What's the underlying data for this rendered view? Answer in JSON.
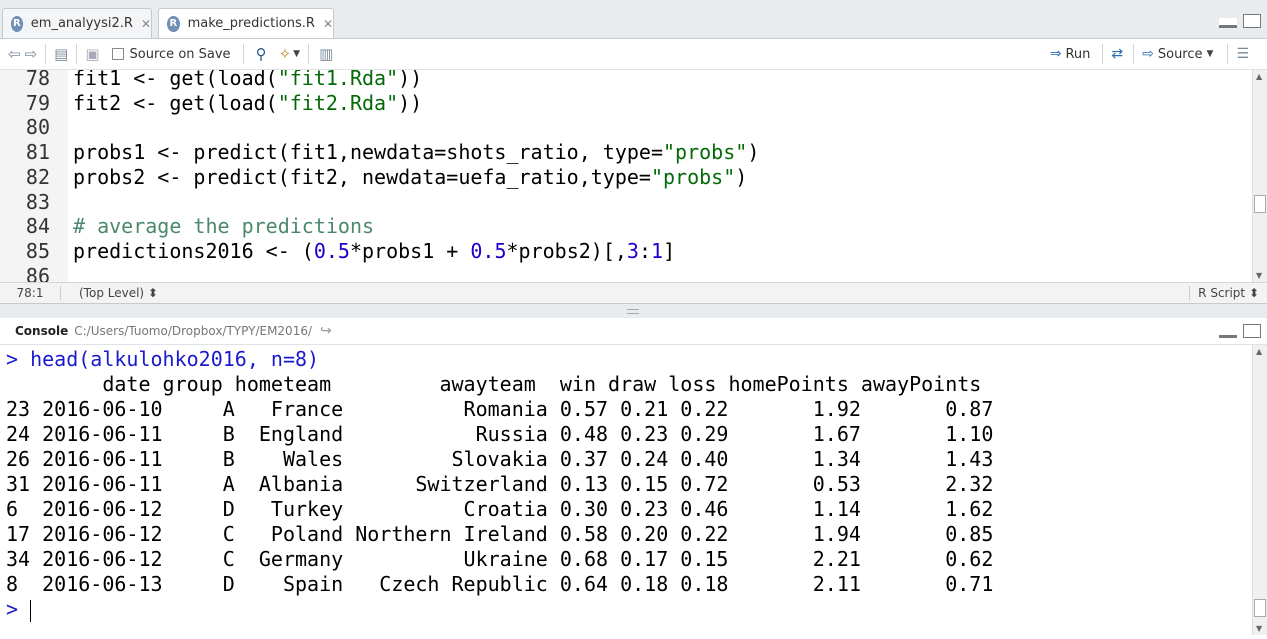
{
  "tabs": [
    {
      "label": "em_analyysi2.R",
      "active": false
    },
    {
      "label": "make_predictions.R",
      "active": true
    }
  ],
  "toolbar": {
    "source_on_save": "Source on Save",
    "run": "Run",
    "source": "Source"
  },
  "editor": {
    "lines": [
      {
        "num": "78",
        "tokens": [
          {
            "t": "fit1 <- get(load(",
            "c": ""
          },
          {
            "t": "\"fit1.Rda\"",
            "c": "str"
          },
          {
            "t": "))",
            "c": ""
          }
        ]
      },
      {
        "num": "79",
        "tokens": [
          {
            "t": "fit2 <- get(load(",
            "c": ""
          },
          {
            "t": "\"fit2.Rda\"",
            "c": "str"
          },
          {
            "t": "))",
            "c": ""
          }
        ]
      },
      {
        "num": "80",
        "tokens": []
      },
      {
        "num": "81",
        "tokens": [
          {
            "t": "probs1 <- predict(fit1,newdata=shots_ratio, type=",
            "c": ""
          },
          {
            "t": "\"probs\"",
            "c": "str"
          },
          {
            "t": ")",
            "c": ""
          }
        ]
      },
      {
        "num": "82",
        "tokens": [
          {
            "t": "probs2 <- predict(fit2, newdata=uefa_ratio,type=",
            "c": ""
          },
          {
            "t": "\"probs\"",
            "c": "str"
          },
          {
            "t": ")",
            "c": ""
          }
        ]
      },
      {
        "num": "83",
        "tokens": []
      },
      {
        "num": "84",
        "tokens": [
          {
            "t": "# average the predictions",
            "c": "cmt"
          }
        ]
      },
      {
        "num": "85",
        "tokens": [
          {
            "t": "predictions2016 <- (",
            "c": ""
          },
          {
            "t": "0.5",
            "c": "num"
          },
          {
            "t": "*probs1 + ",
            "c": ""
          },
          {
            "t": "0.5",
            "c": "num"
          },
          {
            "t": "*probs2)[,",
            "c": ""
          },
          {
            "t": "3",
            "c": "num"
          },
          {
            "t": ":",
            "c": ""
          },
          {
            "t": "1",
            "c": "num"
          },
          {
            "t": "]",
            "c": ""
          }
        ]
      },
      {
        "num": "86",
        "tokens": []
      }
    ]
  },
  "status": {
    "position": "78:1",
    "scope": "(Top Level) ⬍",
    "filetype": "R Script ⬍"
  },
  "console": {
    "title": "Console",
    "path": "C:/Users/Tuomo/Dropbox/TYPY/EM2016/",
    "command": "head(alkulohko2016, n=8)",
    "header_line": "        date group hometeam         awayteam  win draw loss homePoints awayPoints",
    "rows": [
      "23 2016-06-10     A   France          Romania 0.57 0.21 0.22       1.92       0.87",
      "24 2016-06-11     B  England           Russia 0.48 0.23 0.29       1.67       1.10",
      "26 2016-06-11     B    Wales         Slovakia 0.37 0.24 0.40       1.34       1.43",
      "31 2016-06-11     A  Albania      Switzerland 0.13 0.15 0.72       0.53       2.32",
      "6  2016-06-12     D   Turkey          Croatia 0.30 0.23 0.46       1.14       1.62",
      "17 2016-06-12     C   Poland Northern Ireland 0.58 0.20 0.22       1.94       0.85",
      "34 2016-06-12     C  Germany          Ukraine 0.68 0.17 0.15       2.21       0.62",
      "8  2016-06-13     D    Spain   Czech Republic 0.64 0.18 0.18       2.11       0.71"
    ],
    "prompt": ">"
  }
}
